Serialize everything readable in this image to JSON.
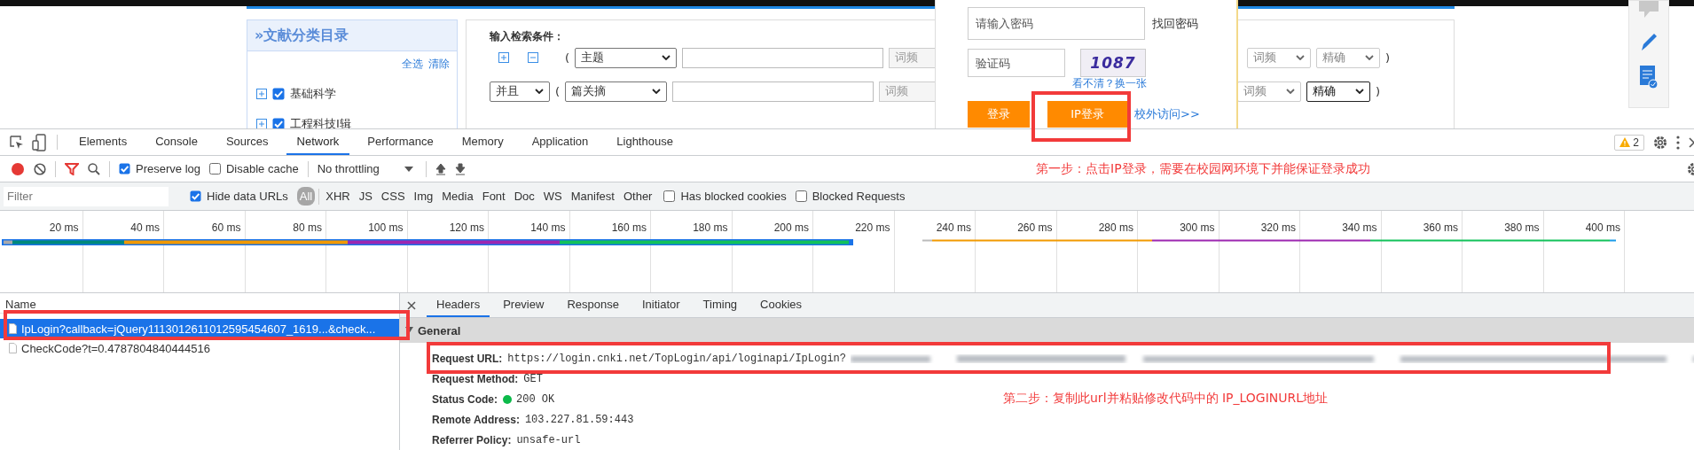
{
  "web_page": {
    "category_panel": {
      "title": "»文献分类目录",
      "actions": [
        "全选",
        "清除"
      ],
      "items": [
        {
          "label": "基础科学",
          "checked": true
        },
        {
          "label": "工程科技Ⅰ辑",
          "checked": true
        }
      ]
    },
    "search_panel": {
      "heading": "输入检索条件：",
      "rows": [
        {
          "kind": "first",
          "open": "(",
          "field": "主题",
          "frequency": "词频",
          "frequency_select": "词频",
          "match": "精确",
          "match_focused": false,
          "close": ")"
        },
        {
          "kind": "joined",
          "logic": "并且",
          "open": "(",
          "field": "篇关摘",
          "frequency": "词频",
          "frequency_select": "词频",
          "match": "精确",
          "match_focused": true,
          "close": ")"
        }
      ]
    },
    "login_popup": {
      "password_placeholder": "请输入密码",
      "forgot_password": "找回密码",
      "captcha_placeholder": "验证码",
      "captcha": "1087",
      "refresh_captcha": "看不清？换一张",
      "login": "登录",
      "ip_login": "IP登录",
      "off_campus": "校外访问>>"
    }
  },
  "devtools": {
    "tabs": [
      {
        "label": "Elements",
        "selected": false
      },
      {
        "label": "Console",
        "selected": false
      },
      {
        "label": "Sources",
        "selected": false
      },
      {
        "label": "Network",
        "selected": true
      },
      {
        "label": "Performance",
        "selected": false
      },
      {
        "label": "Memory",
        "selected": false
      },
      {
        "label": "Application",
        "selected": false
      },
      {
        "label": "Lighthouse",
        "selected": false
      }
    ],
    "warning_count": "2",
    "toolbar": {
      "recording": true,
      "preserve_log": {
        "label": "Preserve log",
        "checked": true
      },
      "disable_cache": {
        "label": "Disable cache",
        "checked": false
      },
      "throttling": "No throttling",
      "annotation": "第一步：点击IP登录，需要在校园网环境下并能保证登录成功"
    },
    "filter_bar": {
      "placeholder": "Filter",
      "hide_data_urls": {
        "label": "Hide data URLs",
        "checked": true
      },
      "types": [
        {
          "label": "All",
          "selected": true
        },
        {
          "label": "XHR",
          "selected": false
        },
        {
          "label": "JS",
          "selected": false
        },
        {
          "label": "CSS",
          "selected": false
        },
        {
          "label": "Img",
          "selected": false
        },
        {
          "label": "Media",
          "selected": false
        },
        {
          "label": "Font",
          "selected": false
        },
        {
          "label": "Doc",
          "selected": false
        },
        {
          "label": "WS",
          "selected": false
        },
        {
          "label": "Manifest",
          "selected": false
        },
        {
          "label": "Other",
          "selected": false
        }
      ],
      "has_blocked_cookies": {
        "label": "Has blocked cookies",
        "checked": false
      },
      "blocked_requests": {
        "label": "Blocked Requests",
        "checked": false
      }
    },
    "timeline": {
      "ticks": [
        "20 ms",
        "40 ms",
        "60 ms",
        "80 ms",
        "100 ms",
        "120 ms",
        "140 ms",
        "160 ms",
        "180 ms",
        "200 ms",
        "220 ms",
        "240 ms",
        "260 ms",
        "280 ms",
        "300 ms",
        "320 ms",
        "340 ms",
        "360 ms",
        "380 ms",
        "400 ms"
      ]
    },
    "requests": {
      "column": "Name",
      "rows": [
        {
          "name": "IpLogin?callback=jQuery1113012611012595454607_1619...&check...",
          "selected": true
        },
        {
          "name": "CheckCode?t=0.4787804840444516",
          "selected": false
        }
      ]
    },
    "details": {
      "tabs": [
        {
          "label": "Headers",
          "selected": true
        },
        {
          "label": "Preview",
          "selected": false
        },
        {
          "label": "Response",
          "selected": false
        },
        {
          "label": "Initiator",
          "selected": false
        },
        {
          "label": "Timing",
          "selected": false
        },
        {
          "label": "Cookies",
          "selected": false
        }
      ],
      "section": "General",
      "expanded": true,
      "fields": [
        {
          "kind": "blurred",
          "key": "Request URL:",
          "value": "https://login.cnki.net/TopLogin/api/loginapi/IpLogin?"
        },
        {
          "kind": "plain",
          "key": "Request Method:",
          "value": "GET"
        },
        {
          "kind": "status",
          "key": "Status Code:",
          "value": "200 OK"
        },
        {
          "kind": "plain",
          "key": "Remote Address:",
          "value": "103.227.81.59:443"
        },
        {
          "kind": "plain",
          "key": "Referrer Policy:",
          "value": "unsafe-url"
        }
      ],
      "annotation": "第二步：复制此url并粘贴修改代码中的 IP_LOGINURL地址"
    }
  }
}
